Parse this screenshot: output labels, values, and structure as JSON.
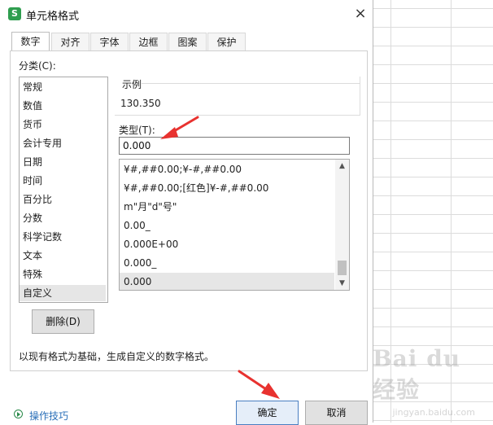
{
  "dialog": {
    "title": "单元格格式",
    "app_icon_letter": "S",
    "close_symbol": "×"
  },
  "tabs": [
    {
      "label": "数字"
    },
    {
      "label": "对齐"
    },
    {
      "label": "字体"
    },
    {
      "label": "边框"
    },
    {
      "label": "图案"
    },
    {
      "label": "保护"
    }
  ],
  "category": {
    "label": "分类(C):",
    "items": [
      {
        "label": "常规"
      },
      {
        "label": "数值"
      },
      {
        "label": "货币"
      },
      {
        "label": "会计专用"
      },
      {
        "label": "日期"
      },
      {
        "label": "时间"
      },
      {
        "label": "百分比"
      },
      {
        "label": "分数"
      },
      {
        "label": "科学记数"
      },
      {
        "label": "文本"
      },
      {
        "label": "特殊"
      },
      {
        "label": "自定义"
      }
    ],
    "selected": "自定义"
  },
  "sample": {
    "label": "示例",
    "value": "130.350"
  },
  "type": {
    "label": "类型(T):",
    "value": "0.000"
  },
  "format_list": [
    {
      "label": "¥#,##0.00;¥-#,##0.00"
    },
    {
      "label": "¥#,##0.00;[红色]¥-#,##0.00"
    },
    {
      "label": "m\"月\"d\"号\""
    },
    {
      "label": "0.00_"
    },
    {
      "label": "0.000E+00"
    },
    {
      "label": "0.000_"
    },
    {
      "label": "0.000"
    }
  ],
  "format_selected": "0.000",
  "delete_button": "删除(D)",
  "description": "以现有格式为基础，生成自定义的数字格式。",
  "footer": {
    "tips_link": "操作技巧",
    "ok_button": "确定",
    "cancel_button": "取消"
  },
  "watermark": {
    "text": "Bai du 经验",
    "sub": "jingyan.baidu.com"
  },
  "colors": {
    "accent_arrow": "#e8322f",
    "link": "#2a6fb8",
    "selection": "#e6e6e6",
    "logo": "#2f9e4f"
  }
}
